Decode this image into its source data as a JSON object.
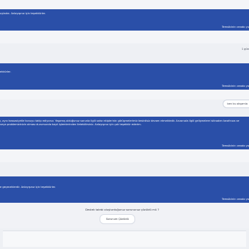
{
  "messages": [
    {
      "text": "uyladın. Anlayışınız için teşekkürler.",
      "signature": "Temsilcinin cevabı yu"
    },
    {
      "text": "ekkürler.",
      "signature": "Temsilcinin cevabı ya"
    },
    {
      "text": "ı, aynı hassasiyetle konuyu takip ediyoruz. Yaşamış olduğunuz sorunla ilgili saha ekiplerinin görüşmelerimiz kesintisiz devam etmektedir. Arızanızla ilgili gelişmelere istinaden tarafınıza ve veya problemizinizin olması durumunda kayıt işlemlerinden iletebilirsiniz. Anlayışınız için çok teşekkür ederim.",
      "signature": "Temsilcinin cevabı ya"
    },
    {
      "text": "e geçeceklerdir. Anlayışınız için teşekkürler.",
      "signature": "Temsilcinin cevabı ya"
    }
  ],
  "user_replies": [
    {
      "text": "1 gün"
    },
    {
      "text": "ben bu akşamla"
    }
  ],
  "feedback": {
    "question": "Destek talebi oluşturduğunuz sorununuz çözüldü mü ?",
    "solved_label": "Sorunum Çözüldü"
  }
}
